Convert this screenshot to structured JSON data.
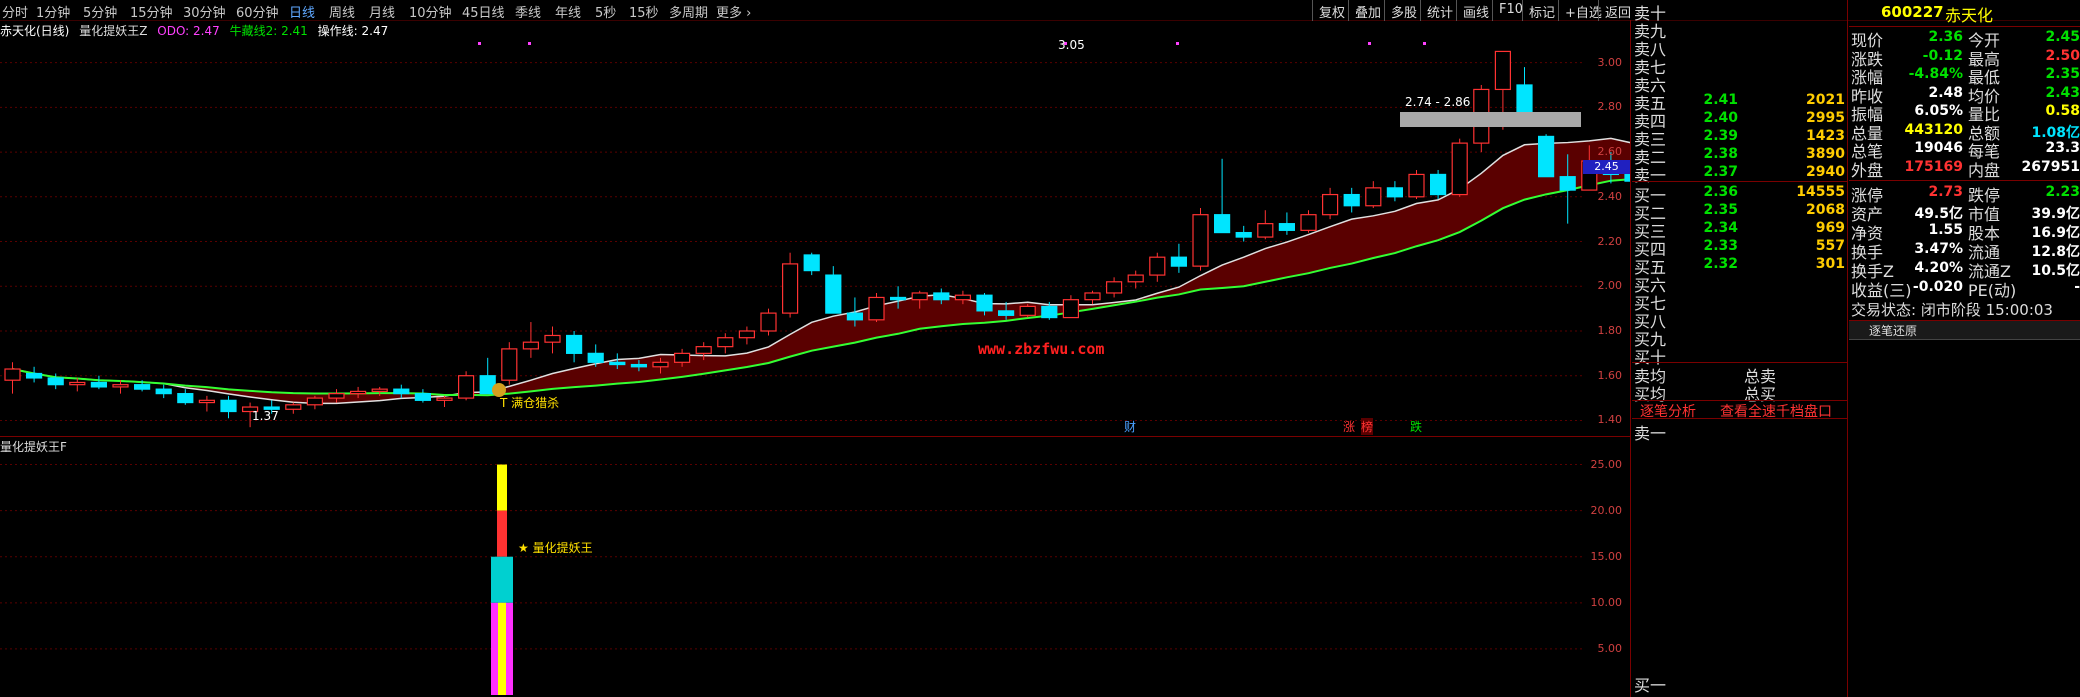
{
  "toolbar": {
    "periods": [
      "分时",
      "1分钟",
      "5分钟",
      "15分钟",
      "30分钟",
      "60分钟",
      "日线",
      "周线",
      "月线",
      "10分钟",
      "45日线",
      "季线",
      "年线",
      "5秒",
      "15秒",
      "多周期",
      "更多"
    ],
    "active_period": "日线",
    "right_buttons": [
      "复权",
      "叠加",
      "多股",
      "统计",
      "画线",
      "F10",
      "标记",
      "+自选",
      "返回"
    ]
  },
  "info": {
    "stock_title": "赤天化(日线)",
    "indicator_name": "量化提妖王Z",
    "odo_label": "ODO: 2.47",
    "niu_label": "牛藏线2: 2.41",
    "op_label": "操作线: 2.47",
    "lower_indicator": "量化提妖王F"
  },
  "price_axis": [
    "3.00",
    "2.80",
    "2.60",
    "2.40",
    "2.20",
    "2.00",
    "1.80",
    "1.60",
    "1.40"
  ],
  "price_tag": "2.45",
  "annotations": {
    "high": "3.05",
    "low": "1.37",
    "zone": "2.74 - 2.86",
    "buy_signal": "T 满仓猎杀",
    "watermark": "www.zbzfwu.com",
    "cai": "财",
    "zhang": "涨",
    "bang": "榜",
    "die": "跌",
    "star_label": "★ 量化提妖王"
  },
  "lower_axis": [
    "25.00",
    "20.00",
    "15.00",
    "10.00",
    "5.00"
  ],
  "chart_data": {
    "type": "candlestick",
    "title": "赤天化(日线)",
    "ylim": [
      1.35,
      3.1
    ],
    "candles": [
      {
        "o": 1.58,
        "h": 1.66,
        "l": 1.52,
        "c": 1.63
      },
      {
        "o": 1.61,
        "h": 1.64,
        "l": 1.57,
        "c": 1.59
      },
      {
        "o": 1.59,
        "h": 1.61,
        "l": 1.54,
        "c": 1.56
      },
      {
        "o": 1.56,
        "h": 1.59,
        "l": 1.53,
        "c": 1.57
      },
      {
        "o": 1.57,
        "h": 1.6,
        "l": 1.54,
        "c": 1.55
      },
      {
        "o": 1.55,
        "h": 1.58,
        "l": 1.52,
        "c": 1.56
      },
      {
        "o": 1.56,
        "h": 1.58,
        "l": 1.53,
        "c": 1.54
      },
      {
        "o": 1.54,
        "h": 1.56,
        "l": 1.5,
        "c": 1.52
      },
      {
        "o": 1.52,
        "h": 1.54,
        "l": 1.47,
        "c": 1.48
      },
      {
        "o": 1.48,
        "h": 1.51,
        "l": 1.44,
        "c": 1.49
      },
      {
        "o": 1.49,
        "h": 1.51,
        "l": 1.41,
        "c": 1.44
      },
      {
        "o": 1.44,
        "h": 1.48,
        "l": 1.37,
        "c": 1.46
      },
      {
        "o": 1.46,
        "h": 1.49,
        "l": 1.43,
        "c": 1.45
      },
      {
        "o": 1.45,
        "h": 1.48,
        "l": 1.43,
        "c": 1.47
      },
      {
        "o": 1.47,
        "h": 1.51,
        "l": 1.45,
        "c": 1.5
      },
      {
        "o": 1.5,
        "h": 1.54,
        "l": 1.48,
        "c": 1.52
      },
      {
        "o": 1.52,
        "h": 1.55,
        "l": 1.5,
        "c": 1.53
      },
      {
        "o": 1.53,
        "h": 1.55,
        "l": 1.51,
        "c": 1.54
      },
      {
        "o": 1.54,
        "h": 1.56,
        "l": 1.5,
        "c": 1.52
      },
      {
        "o": 1.52,
        "h": 1.54,
        "l": 1.48,
        "c": 1.49
      },
      {
        "o": 1.49,
        "h": 1.51,
        "l": 1.46,
        "c": 1.5
      },
      {
        "o": 1.5,
        "h": 1.62,
        "l": 1.49,
        "c": 1.6
      },
      {
        "o": 1.6,
        "h": 1.68,
        "l": 1.56,
        "c": 1.52
      },
      {
        "o": 1.58,
        "h": 1.75,
        "l": 1.56,
        "c": 1.72
      },
      {
        "o": 1.72,
        "h": 1.84,
        "l": 1.68,
        "c": 1.75
      },
      {
        "o": 1.75,
        "h": 1.82,
        "l": 1.7,
        "c": 1.78
      },
      {
        "o": 1.78,
        "h": 1.8,
        "l": 1.66,
        "c": 1.7
      },
      {
        "o": 1.7,
        "h": 1.74,
        "l": 1.64,
        "c": 1.66
      },
      {
        "o": 1.66,
        "h": 1.7,
        "l": 1.63,
        "c": 1.65
      },
      {
        "o": 1.65,
        "h": 1.67,
        "l": 1.62,
        "c": 1.64
      },
      {
        "o": 1.64,
        "h": 1.68,
        "l": 1.61,
        "c": 1.66
      },
      {
        "o": 1.66,
        "h": 1.72,
        "l": 1.64,
        "c": 1.7
      },
      {
        "o": 1.7,
        "h": 1.75,
        "l": 1.67,
        "c": 1.73
      },
      {
        "o": 1.73,
        "h": 1.79,
        "l": 1.7,
        "c": 1.77
      },
      {
        "o": 1.77,
        "h": 1.82,
        "l": 1.74,
        "c": 1.8
      },
      {
        "o": 1.8,
        "h": 1.9,
        "l": 1.78,
        "c": 1.88
      },
      {
        "o": 1.88,
        "h": 2.15,
        "l": 1.86,
        "c": 2.1
      },
      {
        "o": 2.14,
        "h": 2.15,
        "l": 2.05,
        "c": 2.07
      },
      {
        "o": 2.05,
        "h": 2.09,
        "l": 1.88,
        "c": 1.88
      },
      {
        "o": 1.88,
        "h": 1.95,
        "l": 1.82,
        "c": 1.85
      },
      {
        "o": 1.85,
        "h": 1.97,
        "l": 1.84,
        "c": 1.95
      },
      {
        "o": 1.95,
        "h": 2.0,
        "l": 1.9,
        "c": 1.94
      },
      {
        "o": 1.94,
        "h": 1.98,
        "l": 1.9,
        "c": 1.97
      },
      {
        "o": 1.97,
        "h": 1.99,
        "l": 1.92,
        "c": 1.94
      },
      {
        "o": 1.94,
        "h": 1.98,
        "l": 1.92,
        "c": 1.96
      },
      {
        "o": 1.96,
        "h": 1.97,
        "l": 1.87,
        "c": 1.89
      },
      {
        "o": 1.89,
        "h": 1.93,
        "l": 1.85,
        "c": 1.87
      },
      {
        "o": 1.87,
        "h": 1.92,
        "l": 1.86,
        "c": 1.91
      },
      {
        "o": 1.91,
        "h": 1.93,
        "l": 1.85,
        "c": 1.86
      },
      {
        "o": 1.86,
        "h": 1.96,
        "l": 1.86,
        "c": 1.94
      },
      {
        "o": 1.94,
        "h": 1.98,
        "l": 1.92,
        "c": 1.97
      },
      {
        "o": 1.97,
        "h": 2.04,
        "l": 1.95,
        "c": 2.02
      },
      {
        "o": 2.02,
        "h": 2.07,
        "l": 1.99,
        "c": 2.05
      },
      {
        "o": 2.05,
        "h": 2.15,
        "l": 2.02,
        "c": 2.13
      },
      {
        "o": 2.13,
        "h": 2.19,
        "l": 2.06,
        "c": 2.09
      },
      {
        "o": 2.09,
        "h": 2.35,
        "l": 2.07,
        "c": 2.32
      },
      {
        "o": 2.32,
        "h": 2.57,
        "l": 2.24,
        "c": 2.24
      },
      {
        "o": 2.24,
        "h": 2.27,
        "l": 2.2,
        "c": 2.22
      },
      {
        "o": 2.22,
        "h": 2.34,
        "l": 2.21,
        "c": 2.28
      },
      {
        "o": 2.28,
        "h": 2.33,
        "l": 2.23,
        "c": 2.25
      },
      {
        "o": 2.25,
        "h": 2.34,
        "l": 2.24,
        "c": 2.32
      },
      {
        "o": 2.32,
        "h": 2.44,
        "l": 2.3,
        "c": 2.41
      },
      {
        "o": 2.41,
        "h": 2.44,
        "l": 2.33,
        "c": 2.36
      },
      {
        "o": 2.36,
        "h": 2.47,
        "l": 2.35,
        "c": 2.44
      },
      {
        "o": 2.44,
        "h": 2.47,
        "l": 2.38,
        "c": 2.4
      },
      {
        "o": 2.4,
        "h": 2.52,
        "l": 2.39,
        "c": 2.5
      },
      {
        "o": 2.5,
        "h": 2.52,
        "l": 2.39,
        "c": 2.41
      },
      {
        "o": 2.41,
        "h": 2.66,
        "l": 2.4,
        "c": 2.64
      },
      {
        "o": 2.64,
        "h": 2.9,
        "l": 2.6,
        "c": 2.88
      },
      {
        "o": 2.88,
        "h": 3.05,
        "l": 2.7,
        "c": 3.05
      },
      {
        "o": 2.9,
        "h": 2.98,
        "l": 2.72,
        "c": 2.74
      },
      {
        "o": 2.67,
        "h": 2.68,
        "l": 2.49,
        "c": 2.49
      },
      {
        "o": 2.49,
        "h": 2.59,
        "l": 2.28,
        "c": 2.43
      },
      {
        "o": 2.43,
        "h": 2.63,
        "l": 2.43,
        "c": 2.56
      },
      {
        "o": 2.56,
        "h": 2.6,
        "l": 2.46,
        "c": 2.5
      },
      {
        "o": 2.5,
        "h": 2.52,
        "l": 2.45,
        "c": 2.47
      },
      {
        "o": 2.45,
        "h": 2.49,
        "l": 2.36,
        "c": 2.36
      }
    ],
    "lower_bar": {
      "magenta_to": 10.0,
      "cyan_to": 15.0,
      "red_to": 20.0,
      "yellow_to": 25.0
    }
  },
  "orderbook": {
    "asks_labels": [
      "卖十",
      "卖九",
      "卖八",
      "卖七",
      "卖六",
      "卖五",
      "卖四",
      "卖三",
      "卖二",
      "卖一"
    ],
    "asks": [
      {
        "price": "",
        "vol": ""
      },
      {
        "price": "",
        "vol": ""
      },
      {
        "price": "",
        "vol": ""
      },
      {
        "price": "",
        "vol": ""
      },
      {
        "price": "",
        "vol": ""
      },
      {
        "price": "2.41",
        "vol": "2021"
      },
      {
        "price": "2.40",
        "vol": "2995"
      },
      {
        "price": "2.39",
        "vol": "1423"
      },
      {
        "price": "2.38",
        "vol": "3890"
      },
      {
        "price": "2.37",
        "vol": "2940"
      }
    ],
    "bids_labels": [
      "买一",
      "买二",
      "买三",
      "买四",
      "买五",
      "买六",
      "买七",
      "买八",
      "买九",
      "买十"
    ],
    "bids": [
      {
        "price": "2.36",
        "vol": "14555"
      },
      {
        "price": "2.35",
        "vol": "2068"
      },
      {
        "price": "2.34",
        "vol": "969"
      },
      {
        "price": "2.33",
        "vol": "557"
      },
      {
        "price": "2.32",
        "vol": "301"
      },
      {
        "price": "",
        "vol": ""
      },
      {
        "price": "",
        "vol": ""
      },
      {
        "price": "",
        "vol": ""
      },
      {
        "price": "",
        "vol": ""
      },
      {
        "price": "",
        "vol": ""
      }
    ],
    "avg_sell": "卖均",
    "avg_buy": "买均",
    "total_sell": "总卖",
    "total_buy": "总买",
    "tab_analysis": "逐笔分析",
    "tab_view": "查看全速千档盘口",
    "sell_one_bottom": "卖一",
    "buy_one_bottom": "买一"
  },
  "quote": {
    "code": "600227",
    "name": "赤天化",
    "rows": [
      {
        "l1": "现价",
        "v1": "2.36",
        "c1": "green",
        "l2": "今开",
        "v2": "2.45",
        "c2": "green"
      },
      {
        "l1": "涨跌",
        "v1": "-0.12",
        "c1": "green",
        "l2": "最高",
        "v2": "2.50",
        "c2": "red"
      },
      {
        "l1": "涨幅",
        "v1": "-4.84%",
        "c1": "green",
        "l2": "最低",
        "v2": "2.35",
        "c2": "green"
      },
      {
        "l1": "昨收",
        "v1": "2.48",
        "c1": "white",
        "l2": "均价",
        "v2": "2.43",
        "c2": "green"
      },
      {
        "l1": "振幅",
        "v1": "6.05%",
        "c1": "white",
        "l2": "量比",
        "v2": "0.58",
        "c2": "yellow"
      },
      {
        "l1": "总量",
        "v1": "443120",
        "c1": "yellow",
        "l2": "总额",
        "v2": "1.08亿",
        "c2": "cyan"
      },
      {
        "l1": "总笔",
        "v1": "19046",
        "c1": "white",
        "l2": "每笔",
        "v2": "23.3",
        "c2": "white"
      },
      {
        "l1": "外盘",
        "v1": "175169",
        "c1": "red",
        "l2": "内盘",
        "v2": "267951",
        "c2": "white"
      }
    ],
    "rows2": [
      {
        "l1": "涨停",
        "v1": "2.73",
        "c1": "red",
        "l2": "跌停",
        "v2": "2.23",
        "c2": "green"
      },
      {
        "l1": "资产",
        "v1": "49.5亿",
        "c1": "white",
        "l2": "市值",
        "v2": "39.9亿",
        "c2": "white"
      },
      {
        "l1": "净资",
        "v1": "1.55",
        "c1": "white",
        "l2": "股本",
        "v2": "16.9亿",
        "c2": "white"
      },
      {
        "l1": "换手",
        "v1": "3.47%",
        "c1": "white",
        "l2": "流通",
        "v2": "12.8亿",
        "c2": "white"
      },
      {
        "l1": "换手Z",
        "v1": "4.20%",
        "c1": "white",
        "l2": "流通Z",
        "v2": "10.5亿",
        "c2": "white"
      },
      {
        "l1": "收益(三)",
        "v1": "-0.020",
        "c1": "white",
        "l2": "PE(动)",
        "v2": "-",
        "c2": "white"
      }
    ],
    "trade_status": "交易状态: 闭市阶段 15:00:03",
    "tick_title": "逐笔还原"
  },
  "colors": {
    "up": "#ff3232",
    "down": "#00e5ff",
    "ma_white": "#e0e0e0",
    "ma_green": "#33ff33",
    "band": "#5a0000"
  }
}
